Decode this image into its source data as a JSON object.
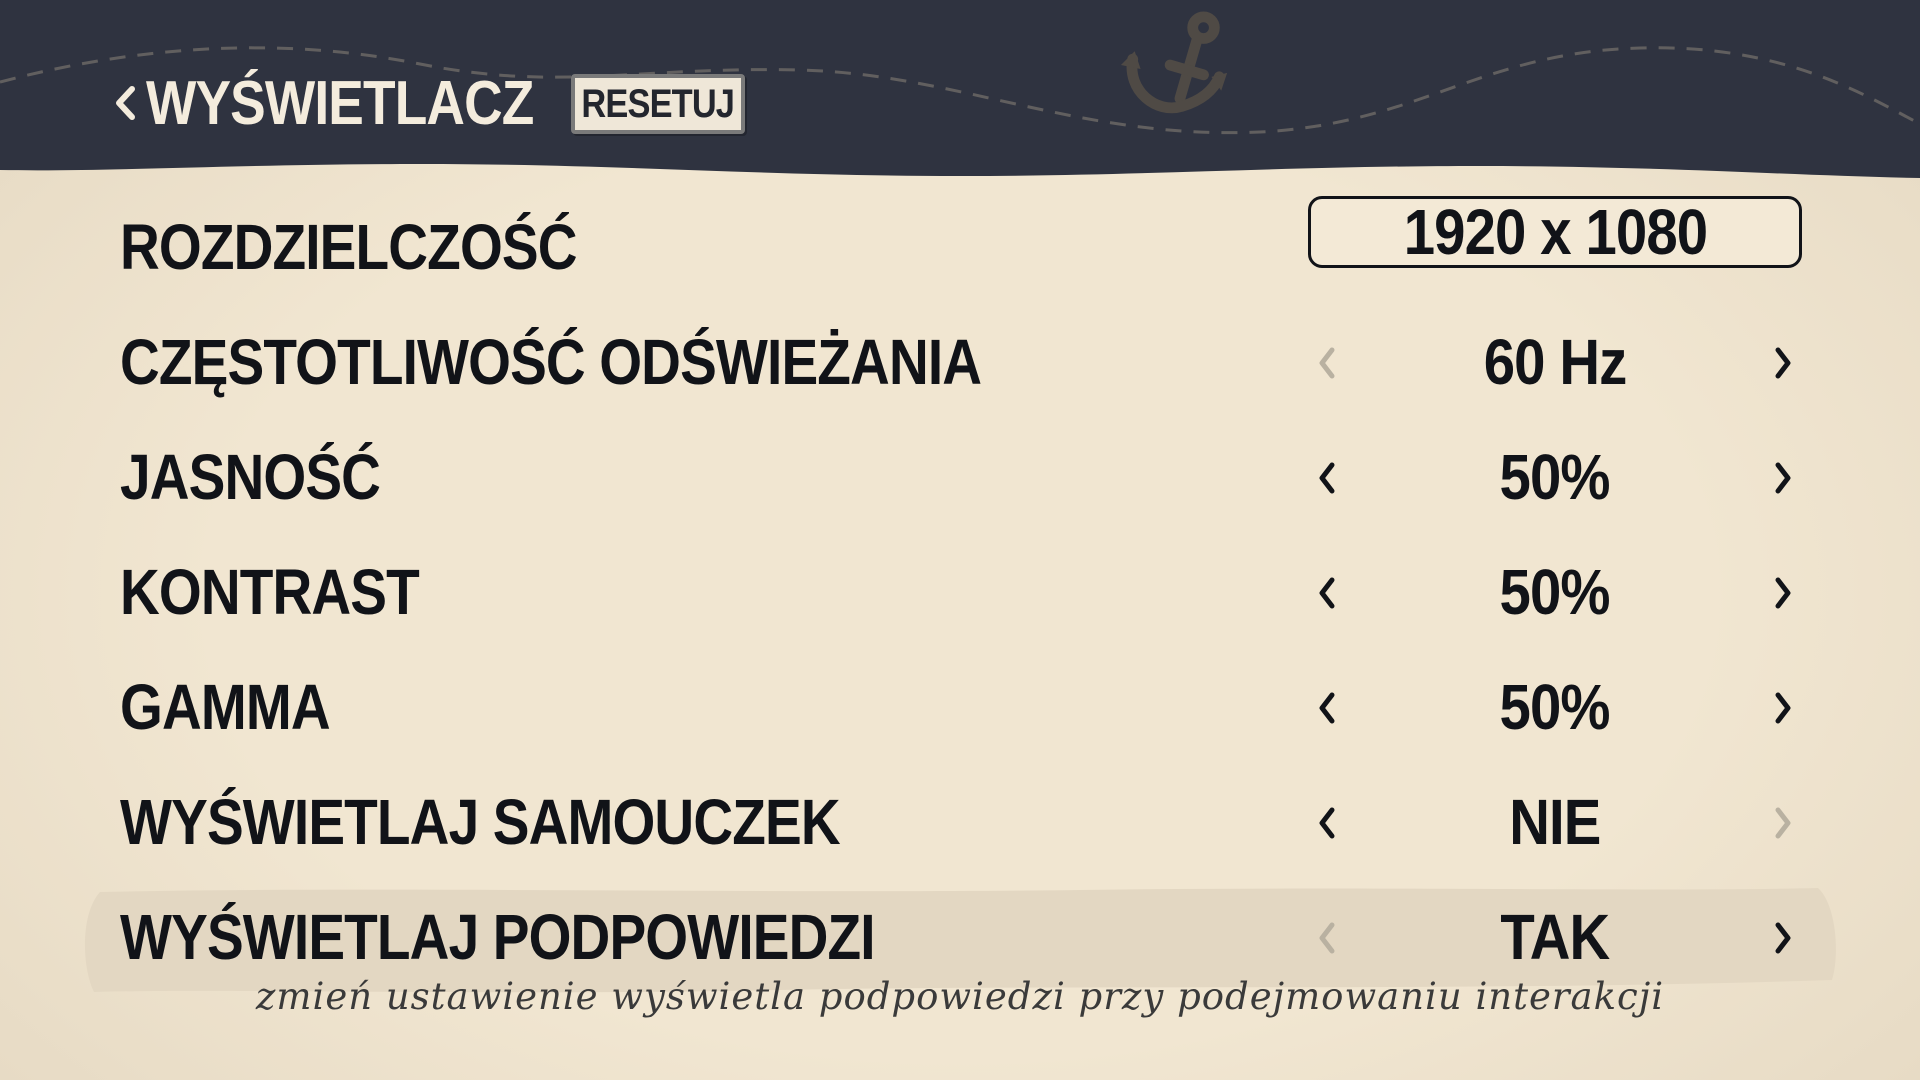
{
  "header": {
    "back_icon": "chevron-left-icon",
    "title": "WYŚWIETLACZ",
    "reset_label": "RESETUJ",
    "decor_icon": "anchor-icon"
  },
  "settings": [
    {
      "label": "ROZDZIELCZOŚĆ",
      "value": "1920 x 1080",
      "control": "dropdown"
    },
    {
      "label": "CZĘSTOTLIWOŚĆ ODŚWIEŻANIA",
      "value": "60 Hz",
      "control": "stepper",
      "left_enabled": false,
      "right_enabled": true
    },
    {
      "label": "JASNOŚĆ",
      "value": "50%",
      "control": "stepper",
      "left_enabled": true,
      "right_enabled": true
    },
    {
      "label": "KONTRAST",
      "value": "50%",
      "control": "stepper",
      "left_enabled": true,
      "right_enabled": true
    },
    {
      "label": "GAMMA",
      "value": "50%",
      "control": "stepper",
      "left_enabled": true,
      "right_enabled": true
    },
    {
      "label": "WYŚWIETLAJ SAMOUCZEK",
      "value": "NIE",
      "control": "stepper",
      "left_enabled": true,
      "right_enabled": false
    },
    {
      "label": "WYŚWIETLAJ PODPOWIEDZI",
      "value": "TAK",
      "control": "stepper",
      "left_enabled": false,
      "right_enabled": true,
      "selected": true
    }
  ],
  "hint": "zmień ustawienie wyświetla podpowiedzi przy podejmowaniu interakcji",
  "colors": {
    "header_bg": "#2f3340",
    "page_bg": "#f1e6d1",
    "text": "#111318",
    "disabled_arrow": "#b9b1a1",
    "highlight": "#e3d7c2"
  }
}
